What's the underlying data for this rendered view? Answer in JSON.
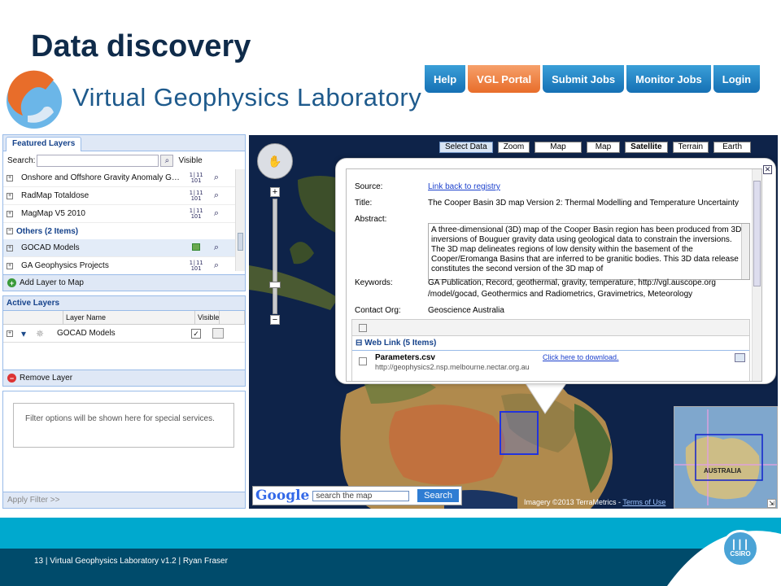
{
  "slide": {
    "title": "Data discovery",
    "footer": "13  |  Virtual Geophysics Laboratory v1.2 | Ryan Fraser",
    "brand": "CSIRO"
  },
  "header": {
    "logo_text": "Virtual Geophysics Laboratory",
    "nav": [
      "Help",
      "VGL Portal",
      "Submit Jobs",
      "Monitor Jobs",
      "Login"
    ],
    "active_nav": "VGL Portal"
  },
  "featured": {
    "tab": "Featured Layers",
    "search_label": "Search:",
    "visible_label": "Visible",
    "layers": [
      "Onshore and Offshore Gravity Anomaly Geod…",
      "RadMap Totaldose",
      "MagMap V5 2010"
    ],
    "group_label": "Others (2 Items)",
    "others": [
      "GOCAD Models",
      "GA Geophysics Projects"
    ],
    "add_layer": "Add Layer to Map"
  },
  "active": {
    "title": "Active Layers",
    "col_name": "Layer Name",
    "col_visible": "Visible",
    "row_name": "GOCAD Models",
    "remove": "Remove Layer"
  },
  "filter": {
    "message": "Filter options will be shown here for special services.",
    "apply": "Apply Filter >>"
  },
  "map": {
    "buttons": [
      "Select Data",
      "Zoom",
      "Map",
      "Map",
      "Satellite",
      "Terrain",
      "Earth"
    ],
    "search_placeholder": "search the map",
    "search_btn": "Search",
    "google": "Google",
    "attribution": "Imagery ©2013 TerraMetrics",
    "terms": "Terms of Use",
    "minimap_label": "AUSTRALIA"
  },
  "popup": {
    "source_label": "Source:",
    "source_link": "Link back to registry",
    "title_label": "Title:",
    "title": "The Cooper Basin 3D map Version 2: Thermal Modelling and Temperature Uncertainty",
    "abstract_label": "Abstract:",
    "abstract": "A three-dimensional (3D) map of the Cooper Basin region has been produced from 3D inversions of Bouguer gravity data using geological data to constrain the inversions. The 3D map delineates regions of low density within the basement of the Cooper/Eromanga Basins that are inferred to be granitic bodies. This 3D data release constitutes the second version of the 3D map of",
    "keywords_label": "Keywords:",
    "keywords1": "GA Publication, Record, geothermal, gravity, temperature, http://vgl.auscope.org",
    "keywords2": "/model/gocad, Geothermics and Radiometrics, Gravimetrics, Meteorology",
    "contact_label": "Contact Org:",
    "contact": "Geoscience Australia",
    "weblink_group": "Web Link (5 Items)",
    "file_name": "Parameters.csv",
    "file_url": "http://geophysics2.nsp.melbourne.nectar.org.au",
    "download": "Click here to download."
  }
}
